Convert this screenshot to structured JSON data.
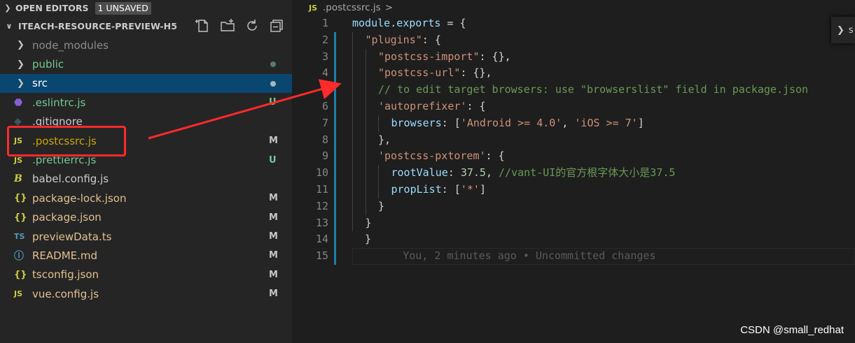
{
  "sidebar": {
    "open_editors_label": "OPEN EDITORS",
    "unsaved_badge": "1 UNSAVED",
    "project_title": "ITEACH-RESOURCE-PREVIEW-H5",
    "actions": [
      "new-file-icon",
      "new-folder-icon",
      "refresh-icon",
      "collapse-all-icon"
    ],
    "items": [
      {
        "type": "folder",
        "name": "node_modules",
        "status": "",
        "dim": true
      },
      {
        "type": "folder",
        "name": "public",
        "status": "dot"
      },
      {
        "type": "folder",
        "name": "src",
        "status": "dot",
        "selected": true
      },
      {
        "type": "file",
        "icon": "eslint",
        "name": ".eslintrc.js",
        "status": "U"
      },
      {
        "type": "file",
        "icon": "git",
        "name": ".gitignore",
        "status": ""
      },
      {
        "type": "file",
        "icon": "JS",
        "name": ".postcssrc.js",
        "status": "M"
      },
      {
        "type": "file",
        "icon": "JS",
        "name": ".prettierrc.js",
        "status": "U"
      },
      {
        "type": "file",
        "icon": "babel",
        "name": "babel.config.js",
        "status": ""
      },
      {
        "type": "file",
        "icon": "{}",
        "name": "package-lock.json",
        "status": "M"
      },
      {
        "type": "file",
        "icon": "{}",
        "name": "package.json",
        "status": "M"
      },
      {
        "type": "file",
        "icon": "TS",
        "name": "previewData.ts",
        "status": "M"
      },
      {
        "type": "file",
        "icon": "info",
        "name": "README.md",
        "status": "M"
      },
      {
        "type": "file",
        "icon": "{}",
        "name": "tsconfig.json",
        "status": "M"
      },
      {
        "type": "file",
        "icon": "JS",
        "name": "vue.config.js",
        "status": "M"
      }
    ]
  },
  "editor": {
    "breadcrumb_icon": "JS",
    "breadcrumb_file": ".postcssrc.js",
    "breadcrumb_sep": ">",
    "peek_label": "s",
    "line_numbers": [
      "1",
      "2",
      "3",
      "4",
      "5",
      "6",
      "7",
      "8",
      "9",
      "10",
      "11",
      "12",
      "13",
      "14",
      "15"
    ],
    "lines": [
      {
        "indent": 0,
        "tokens": [
          [
            "k-var",
            "module"
          ],
          [
            "",
            "."
          ],
          [
            "k-var",
            "exports"
          ],
          [
            "",
            " = {"
          ]
        ]
      },
      {
        "indent": 1,
        "tokens": [
          [
            "k-str",
            "\"plugins\""
          ],
          [
            "",
            ": {"
          ]
        ]
      },
      {
        "indent": 2,
        "tokens": [
          [
            "k-str",
            "\"postcss-import\""
          ],
          [
            "",
            ": {},"
          ]
        ]
      },
      {
        "indent": 2,
        "tokens": [
          [
            "k-str",
            "\"postcss-url\""
          ],
          [
            "",
            ": {},"
          ]
        ]
      },
      {
        "indent": 2,
        "tokens": [
          [
            "k-com",
            "// to edit target browsers: use \"browserslist\" field in package.json"
          ]
        ]
      },
      {
        "indent": 2,
        "tokens": [
          [
            "k-str",
            "'autoprefixer'"
          ],
          [
            "",
            ": {"
          ]
        ]
      },
      {
        "indent": 3,
        "tokens": [
          [
            "k-var",
            "browsers"
          ],
          [
            "",
            ": ["
          ],
          [
            "k-str",
            "'Android >= 4.0'"
          ],
          [
            "",
            ", "
          ],
          [
            "k-str",
            "'iOS >= 7'"
          ],
          [
            "",
            "]"
          ]
        ]
      },
      {
        "indent": 2,
        "tokens": [
          [
            "",
            "},"
          ]
        ]
      },
      {
        "indent": 2,
        "tokens": [
          [
            "k-str",
            "'postcss-pxtorem'"
          ],
          [
            "",
            ": {"
          ]
        ]
      },
      {
        "indent": 3,
        "tokens": [
          [
            "k-var",
            "rootValue"
          ],
          [
            "",
            ": "
          ],
          [
            "k-num",
            "37.5"
          ],
          [
            "",
            ", "
          ],
          [
            "k-com",
            "//vant-UI的官方根字体大小是37.5"
          ]
        ]
      },
      {
        "indent": 3,
        "tokens": [
          [
            "k-var",
            "propList"
          ],
          [
            "",
            ": ["
          ],
          [
            "k-str",
            "'*'"
          ],
          [
            "",
            "]"
          ]
        ]
      },
      {
        "indent": 2,
        "tokens": [
          [
            "",
            "}"
          ]
        ]
      },
      {
        "indent": 1,
        "tokens": [
          [
            "",
            "}"
          ]
        ]
      },
      {
        "indent": 0,
        "tokens": [
          [
            "",
            "  }"
          ]
        ]
      },
      {
        "indent": 0,
        "tokens": [
          [
            "k-blame",
            "        You, 2 minutes ago • Uncommitted changes"
          ]
        ]
      }
    ]
  },
  "watermark": "CSDN @small_redhat",
  "colors": {
    "modified": "#cca700",
    "untracked": "#73c991",
    "annotation_red": "#ff2a2a"
  }
}
